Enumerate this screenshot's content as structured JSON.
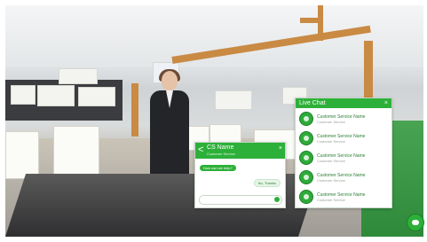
{
  "live_chat": {
    "title": "Live Chat",
    "close_label": "×",
    "agents": [
      {
        "name": "Customer Service Name",
        "role": "Customer Service"
      },
      {
        "name": "Customer Service Name",
        "role": "Customer Service"
      },
      {
        "name": "Customer Service Name",
        "role": "Customer Service"
      },
      {
        "name": "Customer Service Name",
        "role": "Customer Service"
      },
      {
        "name": "Customer Service Name",
        "role": "Customer Service"
      }
    ]
  },
  "cs_chat": {
    "back_label": "<",
    "title": "CS Name",
    "subtitle": "Customer Service",
    "close_label": "×",
    "messages": [
      {
        "from": "agent",
        "text": "How can we help?"
      },
      {
        "from": "user",
        "text": "No, Thanks"
      }
    ],
    "input_placeholder": ""
  },
  "colors": {
    "accent": "#2db039"
  }
}
